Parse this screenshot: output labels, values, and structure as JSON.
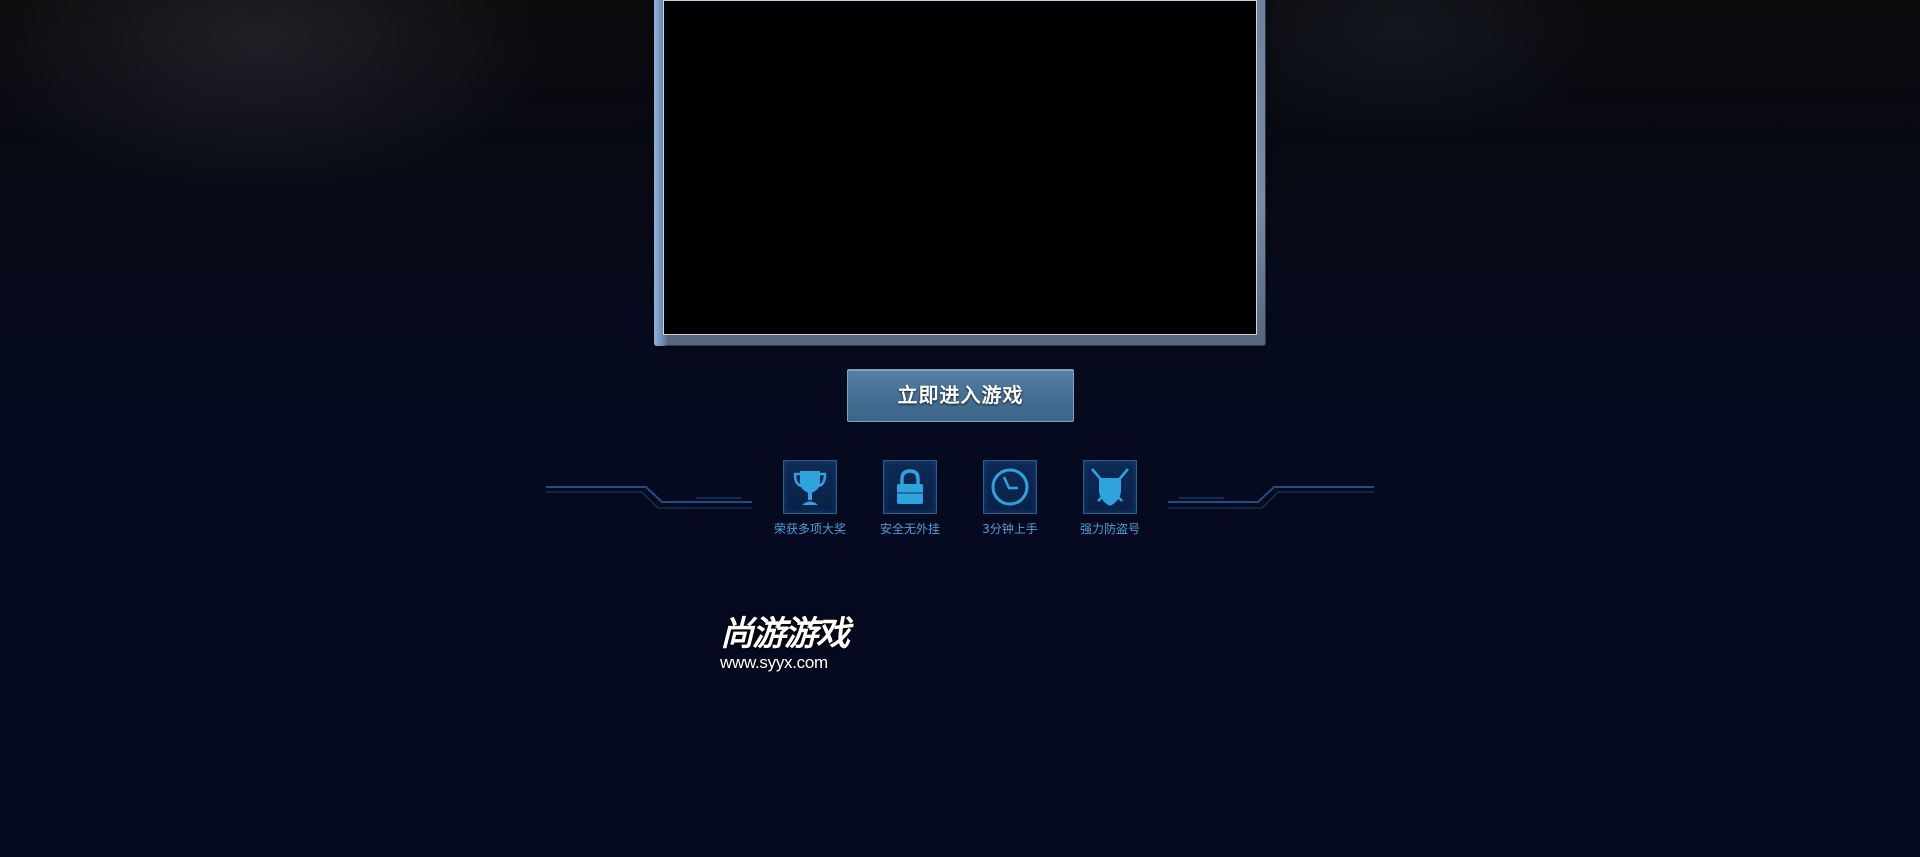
{
  "main": {
    "enter_button_label": "立即进入游戏"
  },
  "features": [
    {
      "label": "荣获多项大奖",
      "icon": "trophy-icon"
    },
    {
      "label": "安全无外挂",
      "icon": "lock-icon"
    },
    {
      "label": "3分钟上手",
      "icon": "clock-icon"
    },
    {
      "label": "强力防盗号",
      "icon": "shield-swords-icon"
    }
  ],
  "footer": {
    "logo_name": "尚游游戏",
    "logo_url": "www.syyx.com"
  },
  "colors": {
    "background": "#050a1e",
    "button": "#456f95",
    "feature_text": "#4a9fd8",
    "icon_tile": "#0d2a55"
  }
}
